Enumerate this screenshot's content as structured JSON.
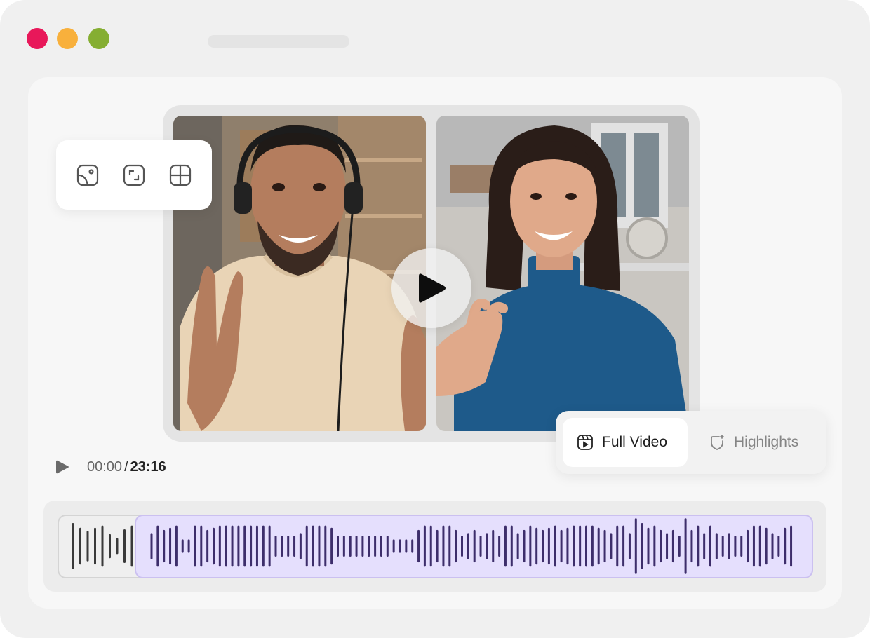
{
  "window": {
    "traffic_lights": [
      {
        "name": "close",
        "color": "#e8185a"
      },
      {
        "name": "minimize",
        "color": "#f8b03c"
      },
      {
        "name": "maximize",
        "color": "#85ae32"
      }
    ]
  },
  "toolbar": {
    "icons": [
      "portrait-layout-icon",
      "expand-frame-icon",
      "grid-layout-icon"
    ]
  },
  "player": {
    "big_play_icon": "play-icon",
    "small_play_icon": "play-icon",
    "current_time": "00:00",
    "separator": "/",
    "total_time": "23:16"
  },
  "view_toggle": {
    "full_video_label": "Full Video",
    "full_video_icon": "video-icon",
    "highlights_label": "Highlights",
    "highlights_icon": "sparkle-shield-icon",
    "selected": "Full Video"
  },
  "timeline": {
    "selection_color": "#e5dffd",
    "bar_color_selected": "#3d2e6b",
    "bar_color_unselected": "#3a3a3a",
    "unselected_bars": [
      0.7,
      0.55,
      0.45,
      0.55,
      0.62,
      0.35,
      0.22,
      0.5,
      0.62
    ],
    "selected_bars": [
      0.38,
      0.62,
      0.48,
      0.55,
      0.62,
      0.18,
      0.18,
      0.62,
      0.62,
      0.48,
      0.55,
      0.62,
      0.62,
      0.62,
      0.62,
      0.62,
      0.62,
      0.62,
      0.62,
      0.62,
      0.3,
      0.3,
      0.3,
      0.3,
      0.38,
      0.62,
      0.62,
      0.62,
      0.62,
      0.55,
      0.3,
      0.3,
      0.3,
      0.3,
      0.3,
      0.3,
      0.3,
      0.3,
      0.3,
      0.18,
      0.18,
      0.18,
      0.18,
      0.48,
      0.62,
      0.62,
      0.48,
      0.62,
      0.62,
      0.48,
      0.3,
      0.38,
      0.48,
      0.3,
      0.38,
      0.48,
      0.3,
      0.62,
      0.62,
      0.38,
      0.48,
      0.62,
      0.55,
      0.48,
      0.55,
      0.62,
      0.48,
      0.55,
      0.62,
      0.62,
      0.62,
      0.62,
      0.55,
      0.48,
      0.38,
      0.62,
      0.62,
      0.38,
      0.85,
      0.7,
      0.55,
      0.62,
      0.48,
      0.38,
      0.48,
      0.3,
      0.85,
      0.48,
      0.62,
      0.38,
      0.62,
      0.38,
      0.3,
      0.38,
      0.3,
      0.3,
      0.48,
      0.62,
      0.62,
      0.55,
      0.38,
      0.3,
      0.55,
      0.62
    ]
  }
}
